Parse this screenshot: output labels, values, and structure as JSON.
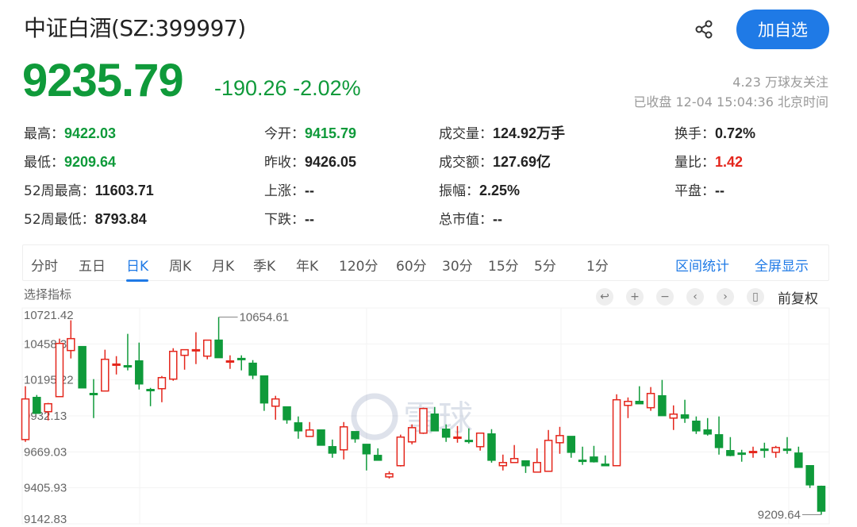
{
  "header": {
    "title": "中证白酒(SZ:399997)",
    "share_icon": "share-icon",
    "follow_label": "加自选",
    "follow_color": "#1f7ae6"
  },
  "quote": {
    "price": "9235.79",
    "change": "-190.26",
    "change_pct": "-2.02%",
    "fans": "4.23 万球友关注",
    "status": "已收盘 12-04 15:04:36 北京时间",
    "down_color": "#0f9a3a",
    "up_color": "#e4261c"
  },
  "stats": [
    {
      "label": "最高：",
      "value": "9422.03",
      "tone": "green"
    },
    {
      "label": "今开：",
      "value": "9415.79",
      "tone": "green"
    },
    {
      "label": "成交量：",
      "value": "124.92万手",
      "tone": ""
    },
    {
      "label": "换手：",
      "value": "0.72%",
      "tone": ""
    },
    {
      "label": "最低：",
      "value": "9209.64",
      "tone": "green"
    },
    {
      "label": "昨收：",
      "value": "9426.05",
      "tone": ""
    },
    {
      "label": "成交额：",
      "value": "127.69亿",
      "tone": ""
    },
    {
      "label": "量比：",
      "value": "1.42",
      "tone": "red"
    },
    {
      "label": "52周最高：",
      "value": "11603.71",
      "tone": ""
    },
    {
      "label": "上涨：",
      "value": "--",
      "tone": ""
    },
    {
      "label": "振幅：",
      "value": "2.25%",
      "tone": ""
    },
    {
      "label": "平盘：",
      "value": "--",
      "tone": ""
    },
    {
      "label": "52周最低：",
      "value": "8793.84",
      "tone": ""
    },
    {
      "label": "下跌：",
      "value": "--",
      "tone": ""
    },
    {
      "label": "总市值：",
      "value": "--",
      "tone": ""
    }
  ],
  "tabs": [
    {
      "label": "分时",
      "active": false
    },
    {
      "label": "五日",
      "active": false
    },
    {
      "label": "日K",
      "active": true
    },
    {
      "label": "周K",
      "active": false
    },
    {
      "label": "月K",
      "active": false
    },
    {
      "label": "季K",
      "active": false
    },
    {
      "label": "年K",
      "active": false
    },
    {
      "label": "120分",
      "active": false
    },
    {
      "label": "60分",
      "active": false
    },
    {
      "label": "30分",
      "active": false
    },
    {
      "label": "15分",
      "active": false
    },
    {
      "label": "5分",
      "active": false
    },
    {
      "label": "1分",
      "active": false
    }
  ],
  "tab_links": [
    "区间统计",
    "全屏显示"
  ],
  "toolbar": {
    "indicator_label": "选择指标",
    "tools": [
      {
        "icon": "undo-icon",
        "glyph": "↩"
      },
      {
        "icon": "zoom-in-icon",
        "glyph": "+"
      },
      {
        "icon": "zoom-out-icon",
        "glyph": "−"
      },
      {
        "icon": "prev-icon",
        "glyph": "‹"
      },
      {
        "icon": "next-icon",
        "glyph": "›"
      },
      {
        "icon": "candle-icon",
        "glyph": "▯"
      }
    ],
    "adjust_label": "前复权"
  },
  "watermark": "雪球",
  "chart_data": {
    "type": "candlestick",
    "ylim": [
      9142.83,
      10721.42
    ],
    "y_ticks": [
      "10721.42",
      "10458.32",
      "10195.22",
      "9932.13",
      "9669.03",
      "9405.93",
      "9142.83"
    ],
    "grid": true,
    "up_color": "#e4261c",
    "down_color": "#0f9a3a",
    "max_label": "10654.61",
    "min_label": "9209.64",
    "ohlc": [
      [
        9759,
        10149,
        9742,
        10056
      ],
      [
        10067,
        10085,
        9951,
        9951
      ],
      [
        9963,
        10027,
        9899,
        10021
      ],
      [
        10073,
        10497,
        10073,
        10462
      ],
      [
        10410,
        10631,
        10352,
        10497
      ],
      [
        10439,
        10439,
        10137,
        10137
      ],
      [
        10096,
        10201,
        9916,
        10090
      ],
      [
        10114,
        10416,
        10114,
        10346
      ],
      [
        10305,
        10369,
        10235,
        10311
      ],
      [
        10299,
        10532,
        10265,
        10293
      ],
      [
        10334,
        10468,
        10125,
        10166
      ],
      [
        10125,
        10137,
        10003,
        10119
      ],
      [
        10131,
        10224,
        10032,
        10212
      ],
      [
        10201,
        10427,
        10189,
        10404
      ],
      [
        10375,
        10416,
        10270,
        10416
      ],
      [
        10410,
        10544,
        10311,
        10416
      ],
      [
        10369,
        10486,
        10346,
        10486
      ],
      [
        10486,
        10654.61,
        10358,
        10358
      ],
      [
        10329,
        10375,
        10276,
        10334
      ],
      [
        10352,
        10375,
        10265,
        10346
      ],
      [
        10317,
        10340,
        10201,
        10230
      ],
      [
        10224,
        10224,
        9969,
        10027
      ],
      [
        10003,
        10079,
        9904,
        10056
      ],
      [
        9998,
        9998,
        9875,
        9904
      ],
      [
        9881,
        9928,
        9765,
        9823
      ],
      [
        9782,
        9887,
        9782,
        9829
      ],
      [
        9829,
        9829,
        9718,
        9718
      ],
      [
        9707,
        9759,
        9626,
        9660
      ],
      [
        9684,
        9887,
        9614,
        9852
      ],
      [
        9817,
        9817,
        9736,
        9765
      ],
      [
        9724,
        9724,
        9533,
        9655
      ],
      [
        9643,
        9695,
        9608,
        9608
      ],
      [
        9486,
        9527,
        9474,
        9509
      ],
      [
        9568,
        9795,
        9562,
        9777
      ],
      [
        9742,
        9870,
        9724,
        9846
      ],
      [
        9806,
        9992,
        9800,
        9986
      ],
      [
        9945,
        9997,
        9823,
        9823
      ],
      [
        9835,
        9870,
        9742,
        9777
      ],
      [
        9771,
        9858,
        9736,
        9777
      ],
      [
        9753,
        9841,
        9730,
        9747
      ],
      [
        9707,
        9806,
        9678,
        9806
      ],
      [
        9800,
        9835,
        9590,
        9608
      ],
      [
        9568,
        9649,
        9533,
        9591
      ],
      [
        9591,
        9719,
        9591,
        9620
      ],
      [
        9603,
        9603,
        9515,
        9568
      ],
      [
        9521,
        9695,
        9521,
        9591
      ],
      [
        9527,
        9829,
        9527,
        9753
      ],
      [
        9736,
        9852,
        9655,
        9788
      ],
      [
        9782,
        9782,
        9626,
        9666
      ],
      [
        9608,
        9707,
        9574,
        9603
      ],
      [
        9631,
        9713,
        9591,
        9597
      ],
      [
        9579,
        9643,
        9568,
        9568
      ],
      [
        9568,
        10090,
        9568,
        10050
      ],
      [
        10009,
        10067,
        9916,
        10038
      ],
      [
        10038,
        10149,
        10021,
        10021
      ],
      [
        9992,
        10143,
        9969,
        10096
      ],
      [
        10079,
        10195,
        9934,
        9934
      ],
      [
        9916,
        10009,
        9829,
        9945
      ],
      [
        9939,
        10050,
        9881,
        9916
      ],
      [
        9893,
        9928,
        9800,
        9823
      ],
      [
        9829,
        9916,
        9788,
        9800
      ],
      [
        9794,
        9928,
        9649,
        9701
      ],
      [
        9678,
        9777,
        9637,
        9643
      ],
      [
        9660,
        9684,
        9597,
        9655
      ],
      [
        9666,
        9707,
        9626,
        9672
      ],
      [
        9689,
        9736,
        9626,
        9684
      ],
      [
        9666,
        9713,
        9626,
        9701
      ],
      [
        9689,
        9777,
        9655,
        9684
      ],
      [
        9660,
        9707,
        9556,
        9556
      ],
      [
        9568,
        9568,
        9405,
        9428
      ],
      [
        9417,
        9422.03,
        9209.64,
        9235.79
      ]
    ]
  }
}
